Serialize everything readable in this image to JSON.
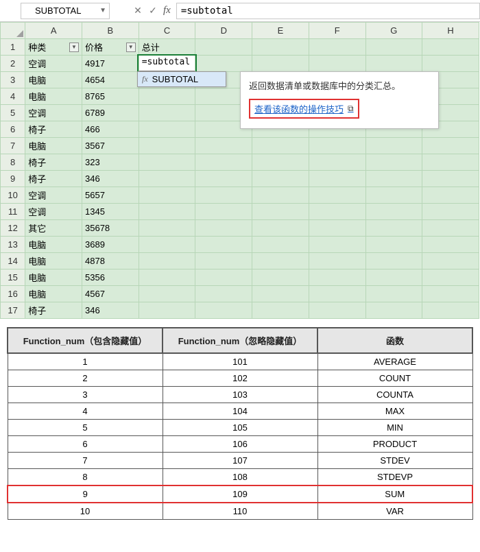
{
  "formula_bar": {
    "name_box": "SUBTOTAL",
    "cancel_glyph": "✕",
    "confirm_glyph": "✓",
    "fx_glyph": "fx",
    "formula_value": "=subtotal"
  },
  "columns": [
    "A",
    "B",
    "C",
    "D",
    "E",
    "F",
    "G",
    "H"
  ],
  "headers": {
    "A": "种类",
    "B": "价格",
    "C": "总计"
  },
  "rows": [
    {
      "n": 1
    },
    {
      "n": 2,
      "A": "空调",
      "B": "4917"
    },
    {
      "n": 3,
      "A": "电脑",
      "B": "4654"
    },
    {
      "n": 4,
      "A": "电脑",
      "B": "8765"
    },
    {
      "n": 5,
      "A": "空调",
      "B": "6789"
    },
    {
      "n": 6,
      "A": "椅子",
      "B": "466"
    },
    {
      "n": 7,
      "A": "电脑",
      "B": "3567"
    },
    {
      "n": 8,
      "A": "椅子",
      "B": "323"
    },
    {
      "n": 9,
      "A": "椅子",
      "B": "346"
    },
    {
      "n": 10,
      "A": "空调",
      "B": "5657"
    },
    {
      "n": 11,
      "A": "空调",
      "B": "1345"
    },
    {
      "n": 12,
      "A": "其它",
      "B": "35678"
    },
    {
      "n": 13,
      "A": "电脑",
      "B": "3689"
    },
    {
      "n": 14,
      "A": "电脑",
      "B": "4878"
    },
    {
      "n": 15,
      "A": "电脑",
      "B": "5356"
    },
    {
      "n": 16,
      "A": "电脑",
      "B": "4567"
    },
    {
      "n": 17,
      "A": "椅子",
      "B": "346"
    }
  ],
  "editing": {
    "cell_value": "=subtotal",
    "ac_item": "SUBTOTAL"
  },
  "tooltip": {
    "desc": "返回数据清单或数据库中的分类汇总。",
    "link_text": "查看该函数的操作技巧",
    "play_glyph": "⧉"
  },
  "ref_table": {
    "headers": [
      "Function_num（包含隐藏值）",
      "Function_num（忽略隐藏值）",
      "函数"
    ],
    "rows": [
      {
        "a": "1",
        "b": "101",
        "c": "AVERAGE"
      },
      {
        "a": "2",
        "b": "102",
        "c": "COUNT"
      },
      {
        "a": "3",
        "b": "103",
        "c": "COUNTA"
      },
      {
        "a": "4",
        "b": "104",
        "c": "MAX"
      },
      {
        "a": "5",
        "b": "105",
        "c": "MIN"
      },
      {
        "a": "6",
        "b": "106",
        "c": "PRODUCT"
      },
      {
        "a": "7",
        "b": "107",
        "c": "STDEV"
      },
      {
        "a": "8",
        "b": "108",
        "c": "STDEVP"
      },
      {
        "a": "9",
        "b": "109",
        "c": "SUM",
        "hl": true
      },
      {
        "a": "10",
        "b": "110",
        "c": "VAR"
      }
    ]
  },
  "chart_data": {
    "type": "table",
    "title": "SUBTOTAL function_num reference",
    "columns": [
      "Function_num（包含隐藏值）",
      "Function_num（忽略隐藏值）",
      "函数"
    ],
    "rows": [
      [
        1,
        101,
        "AVERAGE"
      ],
      [
        2,
        102,
        "COUNT"
      ],
      [
        3,
        103,
        "COUNTA"
      ],
      [
        4,
        104,
        "MAX"
      ],
      [
        5,
        105,
        "MIN"
      ],
      [
        6,
        106,
        "PRODUCT"
      ],
      [
        7,
        107,
        "STDEV"
      ],
      [
        8,
        108,
        "STDEVP"
      ],
      [
        9,
        109,
        "SUM"
      ],
      [
        10,
        110,
        "VAR"
      ]
    ]
  }
}
